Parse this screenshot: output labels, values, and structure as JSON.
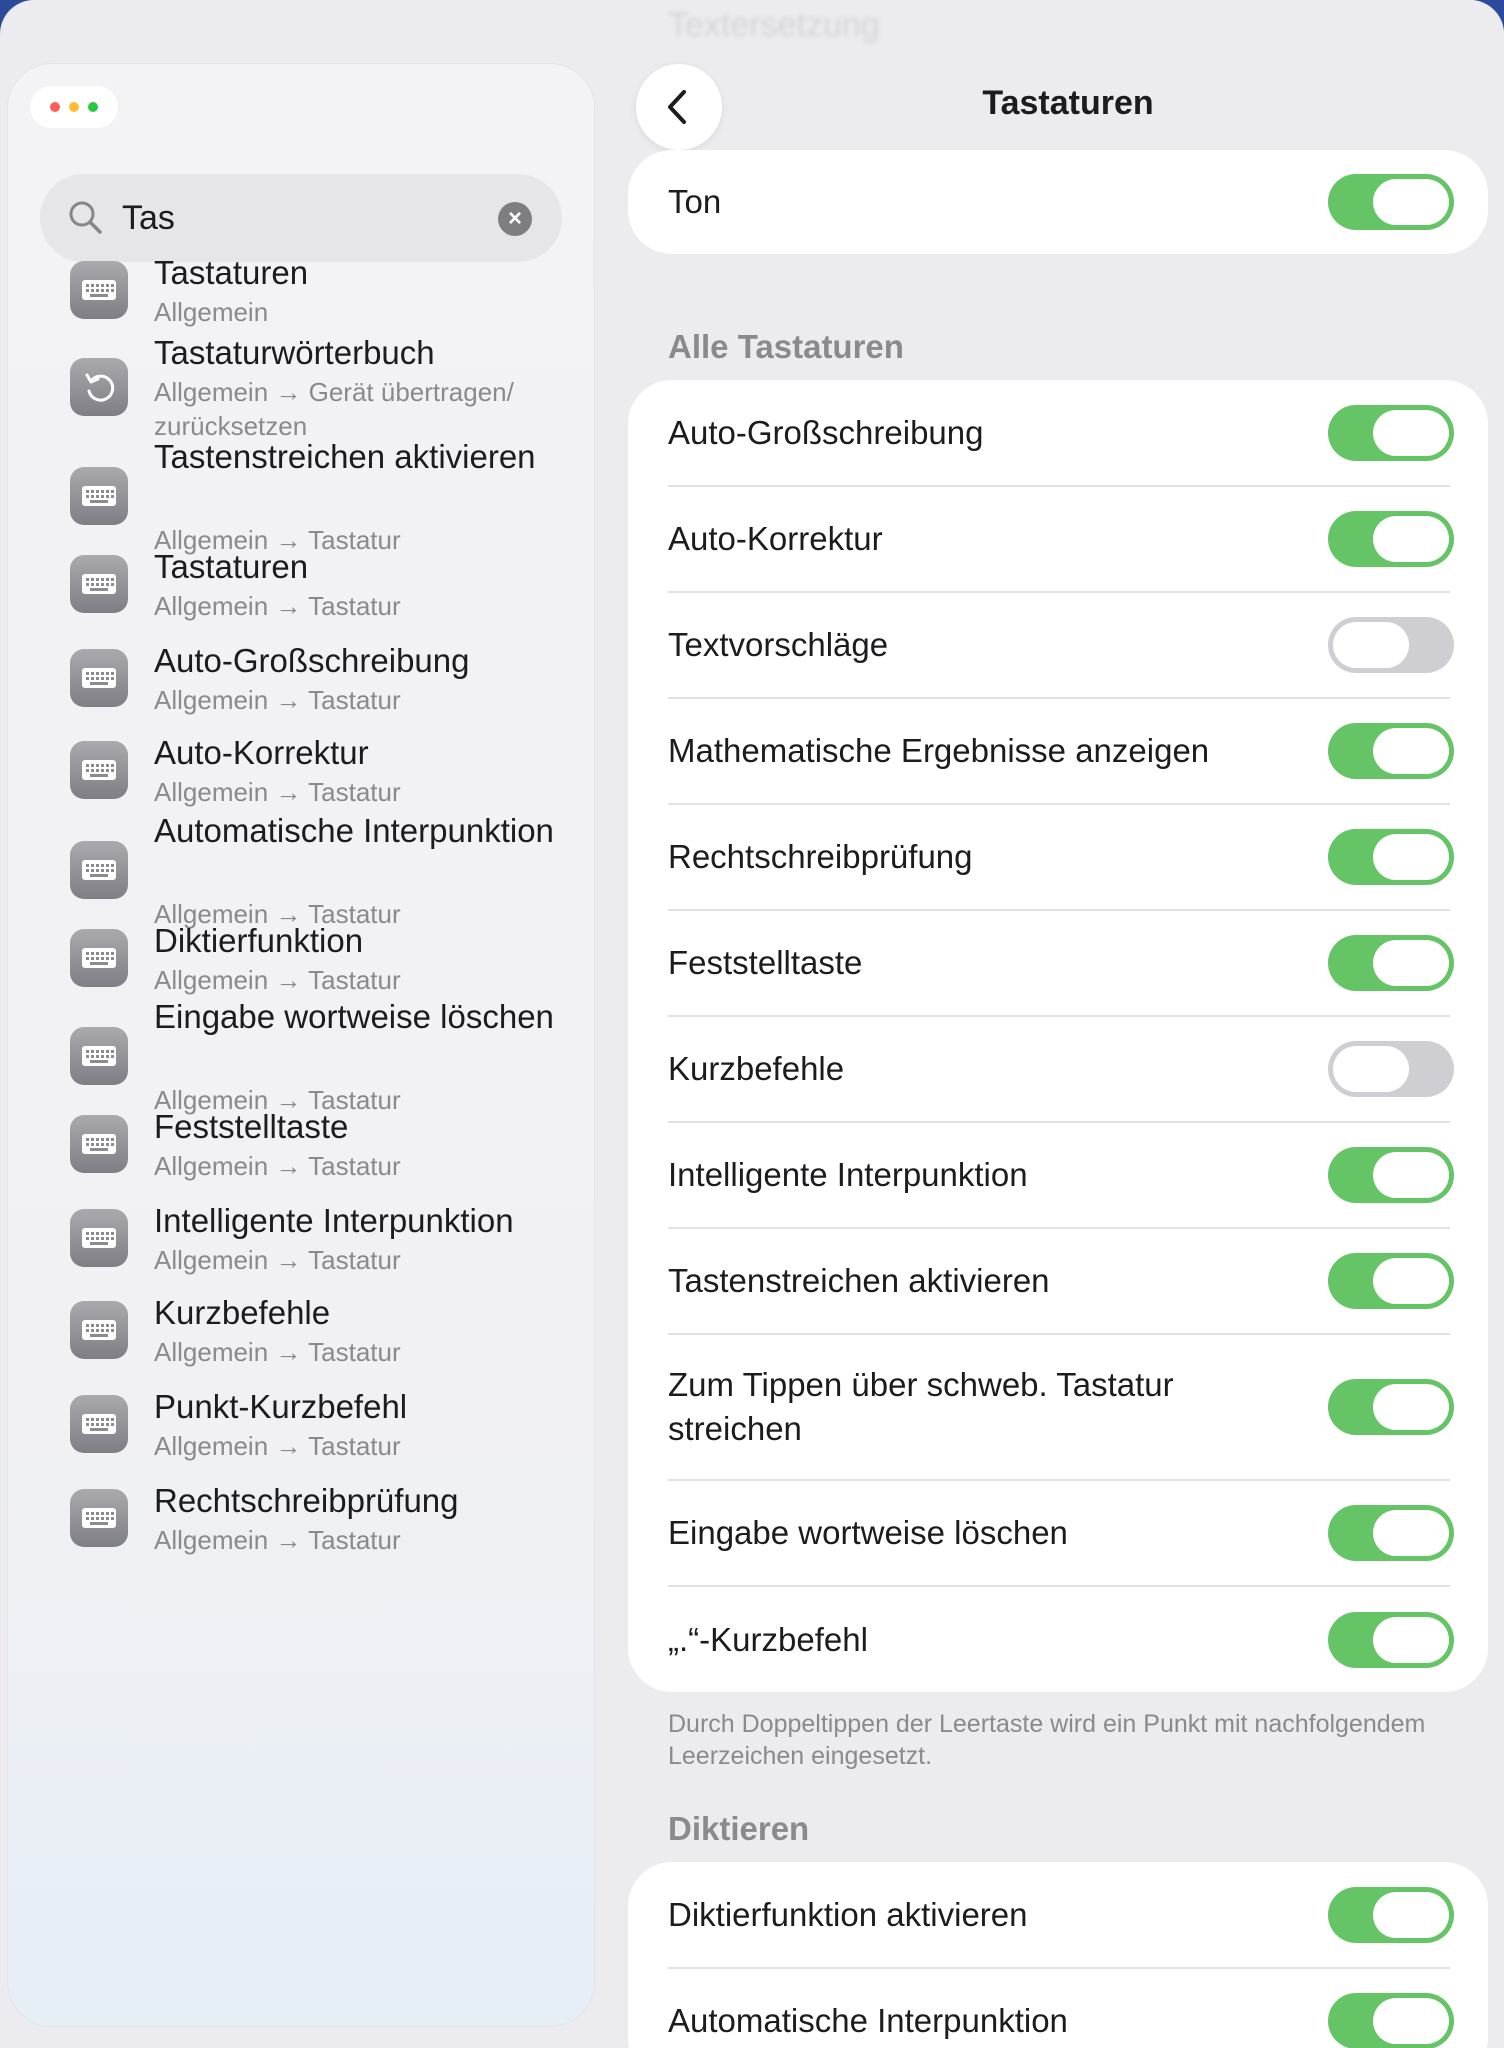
{
  "window": {
    "ghost_title": "Textersetzung"
  },
  "sidebar": {
    "search": {
      "value": "Tas"
    },
    "results": [
      {
        "title": "Tastaturen",
        "subtitle": "Allgemein",
        "icon": "keyboard-icon"
      },
      {
        "title": "Tastaturwörterbuch",
        "subtitle": "Allgemein → Gerät übertragen/ zurücksetzen",
        "icon": "reset-icon"
      },
      {
        "title": "Tastenstreichen aktivieren",
        "subtitle": "Allgemein → Tastatur",
        "icon": "keyboard-icon"
      },
      {
        "title": "Tastaturen",
        "subtitle": "Allgemein → Tastatur",
        "icon": "keyboard-icon"
      },
      {
        "title": "Auto-Großschreibung",
        "subtitle": "Allgemein → Tastatur",
        "icon": "keyboard-icon"
      },
      {
        "title": "Auto-Korrektur",
        "subtitle": "Allgemein → Tastatur",
        "icon": "keyboard-icon"
      },
      {
        "title": "Automatische Interpunktion",
        "subtitle": "Allgemein → Tastatur",
        "icon": "keyboard-icon"
      },
      {
        "title": "Diktierfunktion",
        "subtitle": "Allgemein → Tastatur",
        "icon": "keyboard-icon"
      },
      {
        "title": "Eingabe wortweise löschen",
        "subtitle": "Allgemein → Tastatur",
        "icon": "keyboard-icon"
      },
      {
        "title": "Feststelltaste",
        "subtitle": "Allgemein → Tastatur",
        "icon": "keyboard-icon"
      },
      {
        "title": "Intelligente Interpunktion",
        "subtitle": "Allgemein → Tastatur",
        "icon": "keyboard-icon"
      },
      {
        "title": "Kurzbefehle",
        "subtitle": "Allgemein → Tastatur",
        "icon": "keyboard-icon"
      },
      {
        "title": "Punkt-Kurzbefehl",
        "subtitle": "Allgemein → Tastatur",
        "icon": "keyboard-icon"
      },
      {
        "title": "Rechtschreibprüfung",
        "subtitle": "Allgemein → Tastatur",
        "icon": "keyboard-icon"
      }
    ]
  },
  "detail": {
    "title": "Tastaturen",
    "ton": {
      "label": "Ton",
      "on": true
    },
    "section_all": "Alle Tastaturen",
    "all_rows": [
      {
        "label": "Auto-Großschreibung",
        "on": true
      },
      {
        "label": "Auto-Korrektur",
        "on": true
      },
      {
        "label": "Textvorschläge",
        "on": false
      },
      {
        "label": "Mathematische Ergebnisse anzeigen",
        "on": true
      },
      {
        "label": "Rechtschreibprüfung",
        "on": true
      },
      {
        "label": "Feststelltaste",
        "on": true
      },
      {
        "label": "Kurzbefehle",
        "on": false
      },
      {
        "label": "Intelligente Interpunktion",
        "on": true
      },
      {
        "label": "Tastenstreichen aktivieren",
        "on": true
      },
      {
        "label": "Zum Tippen über schweb. Tastatur streichen",
        "on": true
      },
      {
        "label": "Eingabe wortweise löschen",
        "on": true
      },
      {
        "label": "„.“-Kurzbefehl",
        "on": true
      }
    ],
    "footer": "Durch Doppeltippen der Leertaste wird ein Punkt mit nachfolgendem Leerzeichen eingesetzt.",
    "section_dictation": "Diktieren",
    "dictation_rows": [
      {
        "label": "Diktierfunktion aktivieren",
        "on": true
      },
      {
        "label": "Automatische Interpunktion",
        "on": true
      }
    ]
  },
  "colors": {
    "toggle_on": "#65c466",
    "toggle_off": "#cfcfd3",
    "dot_red": "#ff5f57",
    "dot_yellow": "#febc2e",
    "dot_green": "#28c840"
  }
}
